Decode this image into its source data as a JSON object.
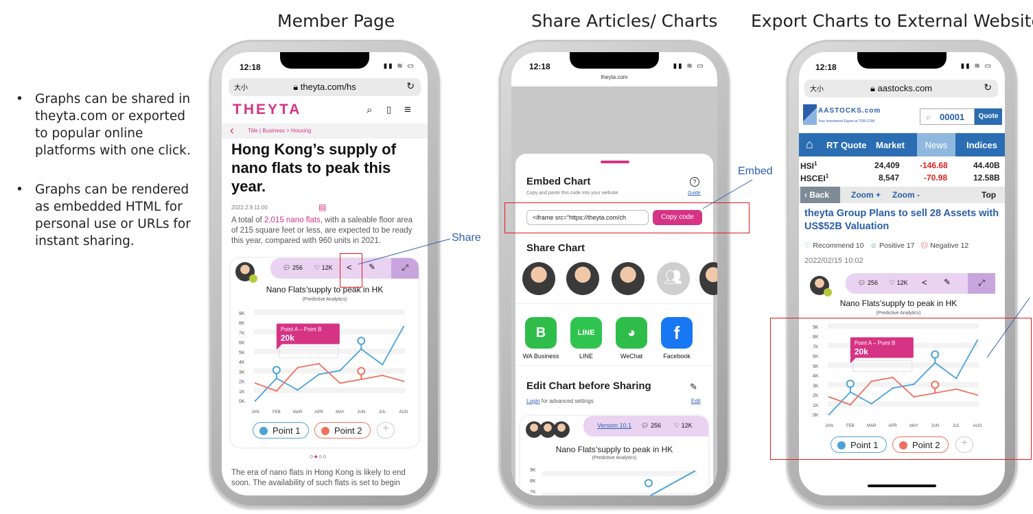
{
  "titles": {
    "member": "Member Page",
    "share": "Share Articles/ Charts",
    "export": "Export Charts to External Website"
  },
  "bullets": [
    "Graphs can be shared in theyta.com or exported to popular online platforms with one click.",
    "Graphs can be rendered as embedded HTML for personal use or URLs for instant sharing."
  ],
  "callouts": {
    "share": "Share",
    "embed": "Embed"
  },
  "phone1": {
    "time": "12:18",
    "aa": "大小",
    "url": "theyta.com/hs",
    "logo": "THEYTA",
    "breadcrumb": "Title | Business > Housing",
    "headline": "Hong Kong’s supply of nano flats to peak this year.",
    "date": "2022.2.9 11:00",
    "body_pre": "A total of ",
    "body_hl": "2,015 nano flats",
    "body_post": ", with a saleable floor area of 215 square feet or less, are expected to be ready this year, compared with 960 units in 2021.",
    "comments": "256",
    "likes": "12K",
    "footer": "The era of nano flats in Hong Kong is likely to end soon. The availability of such flats is set to begin"
  },
  "chart_data": {
    "type": "line",
    "title": "Nano Flats’supply to peak in HK",
    "subtitle": "(Predictive Analytics)",
    "categories": [
      "JAN",
      "FEB",
      "MAR",
      "APR",
      "MAY",
      "JUN",
      "JUL",
      "AUG"
    ],
    "yticks": [
      "9K",
      "8K",
      "7K",
      "6K",
      "5K",
      "4K",
      "3K",
      "2K",
      "1K",
      "0K"
    ],
    "ylim": [
      0,
      9000
    ],
    "series": [
      {
        "name": "Point 1",
        "color": "#4ba3d9",
        "values": [
          0,
          2300,
          1100,
          2700,
          3100,
          5300,
          3700,
          7600
        ]
      },
      {
        "name": "Point 2",
        "color": "#f07060",
        "values": [
          1800,
          1000,
          3400,
          3800,
          1800,
          2200,
          2600,
          2000
        ]
      }
    ],
    "annotation": {
      "label": "Point A – Point B",
      "value": "20k"
    }
  },
  "phone2": {
    "time": "12:18",
    "site": "theyta.com",
    "embed_title": "Embed Chart",
    "embed_sub": "Copy and paste this code into your website",
    "guide": "Guide",
    "code": "<iframe src=“https://theyta.com/ch",
    "copy": "Copy code",
    "share_title": "Share Chart",
    "apps": [
      "WA Business",
      "LINE",
      "WeChat",
      "Facebook"
    ],
    "edit_title": "Edit Chart before Sharing",
    "login": "Login",
    "login_rest": " for advanced settings",
    "edit": "Edit",
    "version": "Version 10.1",
    "comments": "256",
    "likes": "12K",
    "yticks": [
      "9K",
      "8K",
      "7K"
    ]
  },
  "phone3": {
    "time": "12:18",
    "aa": "大小",
    "url": "aastocks.com",
    "logo": "AASTOCKS.com",
    "logo_sub": "Your Investment Expert at TOR.COM",
    "code": "00001",
    "quote": "Quote",
    "nav": [
      "RT Quote",
      "Market",
      "News",
      "Indices"
    ],
    "indices": [
      {
        "name": "HSI",
        "sup": "1",
        "val": "24,409",
        "chg": "-146.68",
        "vol": "44.40B"
      },
      {
        "name": "HSCEI",
        "sup": "1",
        "val": "8,547",
        "chg": "-70.98",
        "vol": "12.58B"
      }
    ],
    "back": "Back",
    "zoomin": "Zoom +",
    "zoomout": "Zoom -",
    "top": "Top",
    "headline": "theyta Group Plans to sell 28 Assets with US$52B Valuation",
    "recommend": "Recommend 10",
    "positive": "Positive 17",
    "negative": "Negative 12",
    "date": "2022/02/15 10:02",
    "comments": "256",
    "likes": "12K"
  }
}
